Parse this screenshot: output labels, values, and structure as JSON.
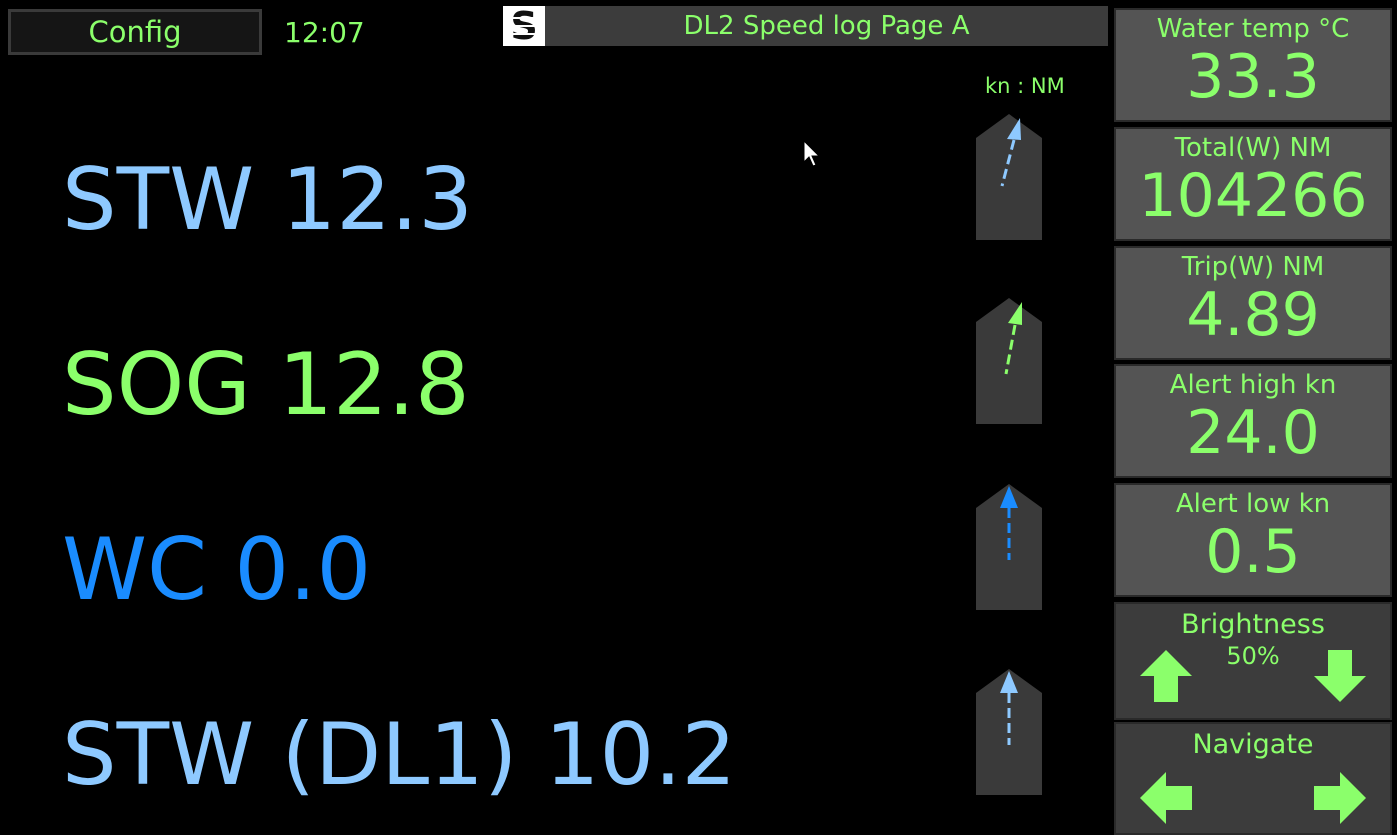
{
  "header": {
    "config_label": "Config",
    "time": "12:07",
    "logo_letter": "S",
    "page_title": "DL2 Speed log Page A",
    "units": "kn : NM"
  },
  "readouts": [
    {
      "label": "STW 12.3",
      "color": "#8ec9ff"
    },
    {
      "label": "SOG 12.8",
      "color": "#8bff6b"
    },
    {
      "label": "WC 0.0",
      "color": "#1a8cff"
    },
    {
      "label": "STW (DL1) 10.2",
      "color": "#8ec9ff"
    }
  ],
  "indicators": [
    {
      "icon": "heading-arrow-icon",
      "color": "#8ec9ff"
    },
    {
      "icon": "heading-arrow-icon",
      "color": "#8bff6b"
    },
    {
      "icon": "heading-arrow-icon",
      "color": "#1a8cff"
    },
    {
      "icon": "heading-arrow-icon",
      "color": "#8ec9ff"
    }
  ],
  "side": {
    "water_temp": {
      "label": "Water temp °C",
      "value": "33.3"
    },
    "total": {
      "label": "Total(W) NM",
      "value": "104266"
    },
    "trip": {
      "label": "Trip(W) NM",
      "value": "4.89"
    },
    "alert_high": {
      "label": "Alert high kn",
      "value": "24.0"
    },
    "alert_low": {
      "label": "Alert low kn",
      "value": "0.5"
    },
    "brightness": {
      "label": "Brightness",
      "value": "50%"
    },
    "navigate": {
      "label": "Navigate"
    }
  },
  "colors": {
    "accent_green": "#8bff6b",
    "light_blue": "#8ec9ff",
    "blue": "#1a8cff",
    "panel_gray": "#545454",
    "dark_gray": "#3c3c3c"
  }
}
